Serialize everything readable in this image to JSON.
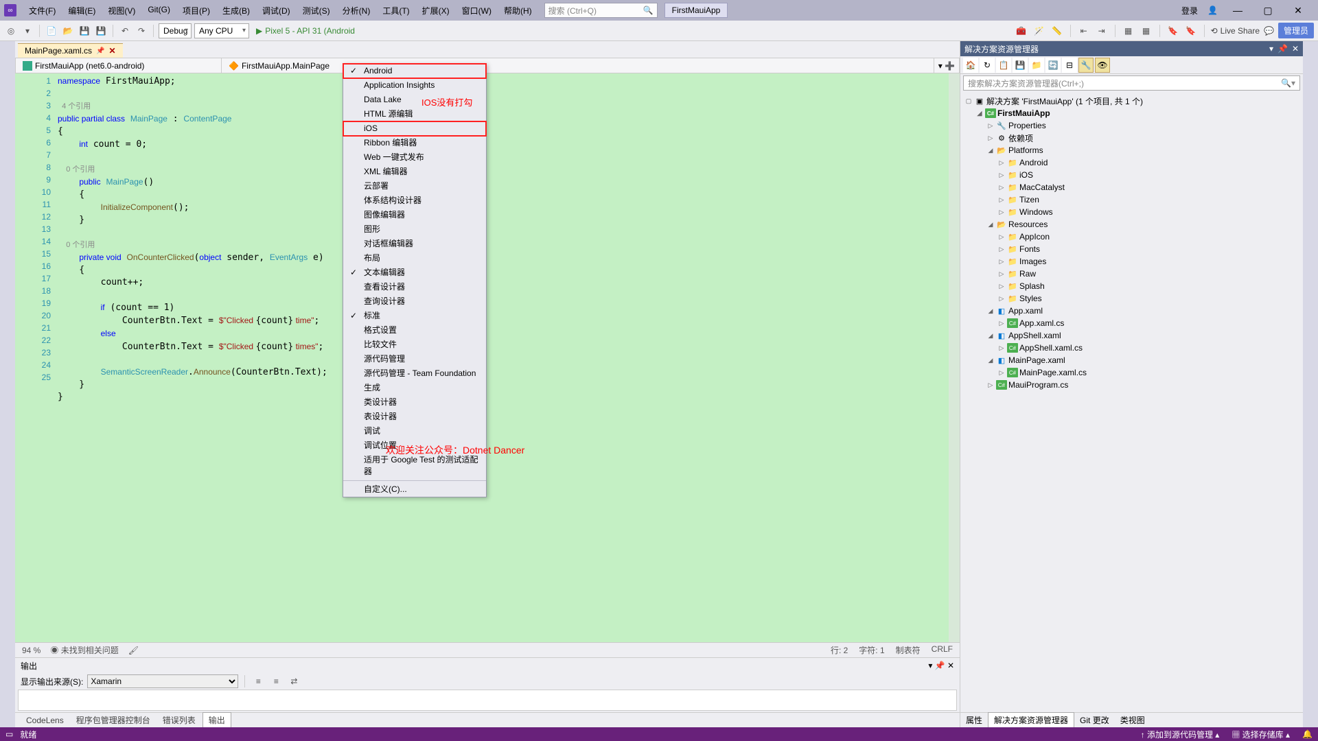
{
  "menu": {
    "items": [
      "文件(F)",
      "编辑(E)",
      "视图(V)",
      "Git(G)",
      "项目(P)",
      "生成(B)",
      "调试(D)",
      "测试(S)",
      "分析(N)",
      "工具(T)",
      "扩展(X)",
      "窗口(W)",
      "帮助(H)"
    ]
  },
  "search": {
    "placeholder": "搜索 (Ctrl+Q)"
  },
  "app_name": "FirstMauiApp",
  "login": "登录",
  "admin_label": "管理员",
  "toolbar": {
    "config": "Debug",
    "platform": "Any CPU",
    "run_target": "Pixel 5 - API 31 (Android",
    "live_share": "Live Share"
  },
  "doctab": {
    "name": "MainPage.xaml.cs"
  },
  "breadcrumb": {
    "item1": "FirstMauiApp (net6.0-android)",
    "item2": "FirstMauiApp.MainPage"
  },
  "dropdown": {
    "items": [
      {
        "label": "Android",
        "checked": true,
        "hl": true
      },
      {
        "label": "Application Insights"
      },
      {
        "label": "Data Lake"
      },
      {
        "label": "HTML 源编辑"
      },
      {
        "label": "iOS",
        "hl": true
      },
      {
        "label": "Ribbon 编辑器"
      },
      {
        "label": "Web 一键式发布"
      },
      {
        "label": "XML 编辑器"
      },
      {
        "label": "云部署"
      },
      {
        "label": "体系结构设计器"
      },
      {
        "label": "图像编辑器"
      },
      {
        "label": "图形"
      },
      {
        "label": "对话框编辑器"
      },
      {
        "label": "布局"
      },
      {
        "label": "文本编辑器",
        "checked": true
      },
      {
        "label": "查看设计器"
      },
      {
        "label": "查询设计器"
      },
      {
        "label": "标准",
        "checked": true
      },
      {
        "label": "格式设置"
      },
      {
        "label": "比较文件"
      },
      {
        "label": "源代码管理"
      },
      {
        "label": "源代码管理 - Team Foundation"
      },
      {
        "label": "生成"
      },
      {
        "label": "类设计器"
      },
      {
        "label": "表设计器"
      },
      {
        "label": "调试"
      },
      {
        "label": "调试位置"
      },
      {
        "label": "适用于 Google Test 的测试适配器"
      }
    ],
    "custom": "自定义(C)..."
  },
  "annot": {
    "ios": "IOS没有打勾",
    "wechat": "欢迎关注公众号：Dotnet Dancer"
  },
  "code": {
    "ref1": "4 个引用",
    "ref0a": "0 个引用",
    "ref0b": "0 个引用"
  },
  "edstatus": {
    "zoom": "94 %",
    "issues": "未找到相关问题",
    "line": "行: 2",
    "char": "字符: 1",
    "tabs": "制表符",
    "crlf": "CRLF"
  },
  "output": {
    "title": "输出",
    "source_label": "显示输出来源(S):",
    "source_value": "Xamarin"
  },
  "bottom_tabs": [
    "CodeLens",
    "程序包管理器控制台",
    "错误列表",
    "输出"
  ],
  "statusbar": {
    "ready": "就绪",
    "add_src": "添加到源代码管理",
    "select_repo": "选择存储库"
  },
  "solexp": {
    "title": "解决方案资源管理器",
    "search_placeholder": "搜索解决方案资源管理器(Ctrl+;)",
    "sln": "解决方案 'FirstMauiApp' (1 个项目, 共 1 个)",
    "proj": "FirstMauiApp",
    "nodes": {
      "properties": "Properties",
      "deps": "依赖项",
      "platforms": "Platforms",
      "android": "Android",
      "ios": "iOS",
      "mac": "MacCatalyst",
      "tizen": "Tizen",
      "windows": "Windows",
      "resources": "Resources",
      "appicon": "AppIcon",
      "fonts": "Fonts",
      "images": "Images",
      "raw": "Raw",
      "splash": "Splash",
      "styles": "Styles",
      "appxaml": "App.xaml",
      "appxamlcs": "App.xaml.cs",
      "appshell": "AppShell.xaml",
      "appshellcs": "AppShell.xaml.cs",
      "mainpage": "MainPage.xaml",
      "mainpagecs": "MainPage.xaml.cs",
      "mauiprog": "MauiProgram.cs"
    },
    "prop_tabs": [
      "属性",
      "解决方案资源管理器",
      "Git 更改",
      "类视图"
    ]
  }
}
